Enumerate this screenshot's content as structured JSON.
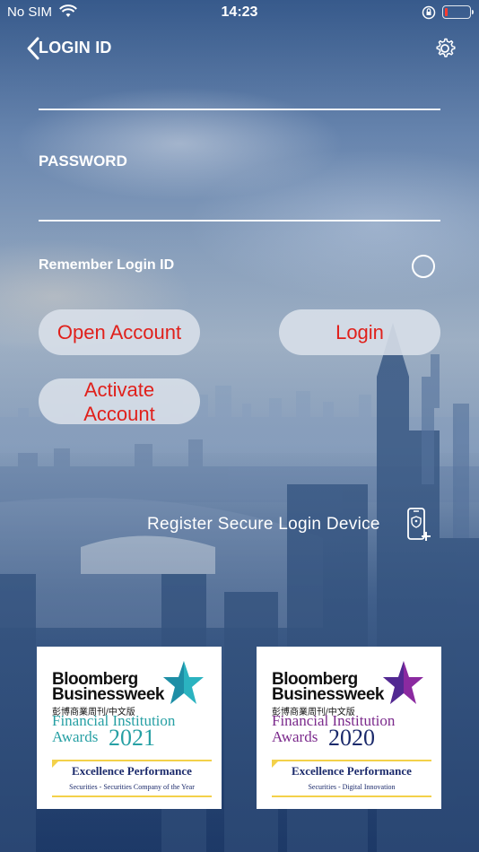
{
  "status_bar": {
    "carrier": "No SIM",
    "time": "14:23",
    "battery_percent": 10,
    "battery_color": "#ff3b30"
  },
  "header": {
    "title": "LOGIN ID"
  },
  "form": {
    "login_id_value": "",
    "password_label": "PASSWORD",
    "password_value": "",
    "remember_label": "Remember Login ID",
    "remember_checked": false
  },
  "buttons": {
    "open_account": "Open Account",
    "login": "Login",
    "activate_account": "Activate Account",
    "text_color": "#e0201b"
  },
  "secure_device": {
    "label": "Register Secure Login Device"
  },
  "awards": [
    {
      "brand_line1": "Bloomberg",
      "brand_line2": "Businessweek",
      "chinese": "彭博商業周刊/中文版",
      "title_line1": "Financial Institution",
      "title_line2": "Awards",
      "year": "2021",
      "accent_color": "#27a0a4",
      "star_color": "#2bb3c0",
      "category": "Excellence Performance",
      "subcategory": "Securities - Securities Company of the Year"
    },
    {
      "brand_line1": "Bloomberg",
      "brand_line2": "Businessweek",
      "chinese": "彭博商業周刊/中文版",
      "title_line1": "Financial Institution",
      "title_line2": "Awards",
      "year": "2020",
      "accent_color": "#7b2a8c",
      "star_color": "#8b2aa0",
      "category": "Excellence Performance",
      "subcategory": "Securities - Digital Innovation"
    }
  ]
}
